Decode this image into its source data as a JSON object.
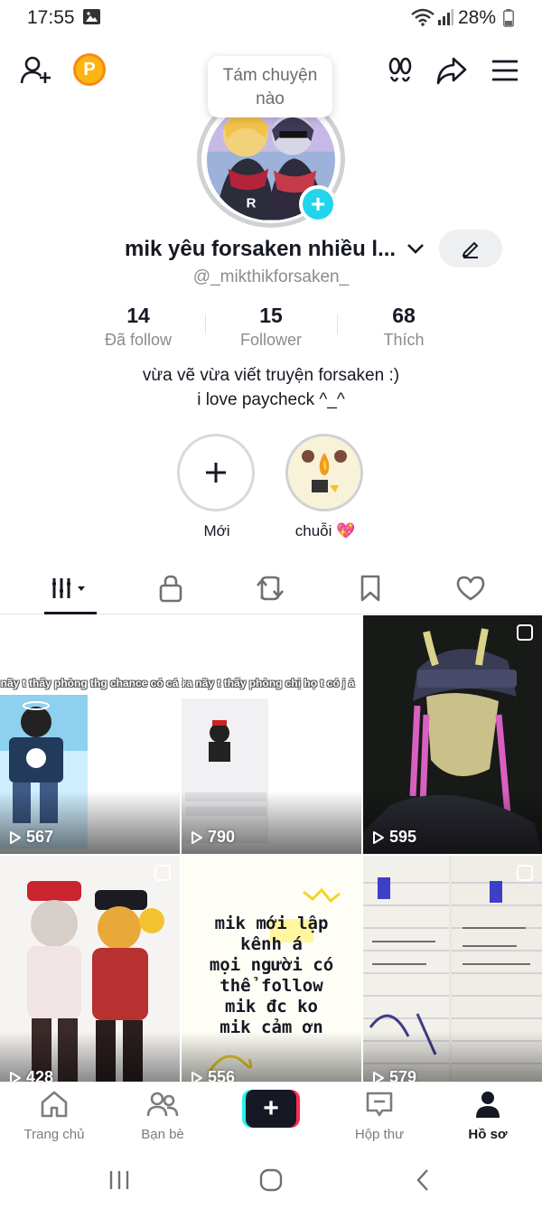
{
  "status_bar": {
    "time": "17:55",
    "battery": "28%"
  },
  "tooltip": {
    "text": "Tám chuyện nào"
  },
  "profile": {
    "display_name": "mik yêu forsaken nhiều l...",
    "username": "@_mikthikforsaken_",
    "stats": [
      {
        "value": "14",
        "label": "Đã follow"
      },
      {
        "value": "15",
        "label": "Follower"
      },
      {
        "value": "68",
        "label": "Thích"
      }
    ],
    "bio_line1": "vừa vẽ vừa viết truyện forsaken :)",
    "bio_line2": "i love paycheck ^_^"
  },
  "highlights": [
    {
      "label": "Mới"
    },
    {
      "label": "chuỗi 💖"
    }
  ],
  "videos": [
    {
      "views": "567",
      "caption": "n nãy t thấy phòng thg chance có cá"
    },
    {
      "views": "790",
      "caption": "vừa nãy t thấy phòng chị họ t có j á"
    },
    {
      "views": "595",
      "caption": ""
    },
    {
      "views": "428",
      "caption": ""
    },
    {
      "views": "556",
      "caption": "mik mới lập kênh á mọi người có thể follow mik đc ko mik cảm ơn"
    },
    {
      "views": "579",
      "caption": ""
    }
  ],
  "tile5_lines": [
    "mik mới lập",
    "kênh á",
    "mọi người có",
    "thể follow",
    "mik đc ko",
    "mik cảm ơn"
  ],
  "bottom_nav": {
    "home": "Trang chủ",
    "friends": "Bạn bè",
    "inbox": "Hộp thư",
    "profile": "Hồ sơ"
  },
  "colors": {
    "accent_cyan": "#20d5ec",
    "brand_red": "#fe2c55",
    "coin": "#fdb515"
  }
}
